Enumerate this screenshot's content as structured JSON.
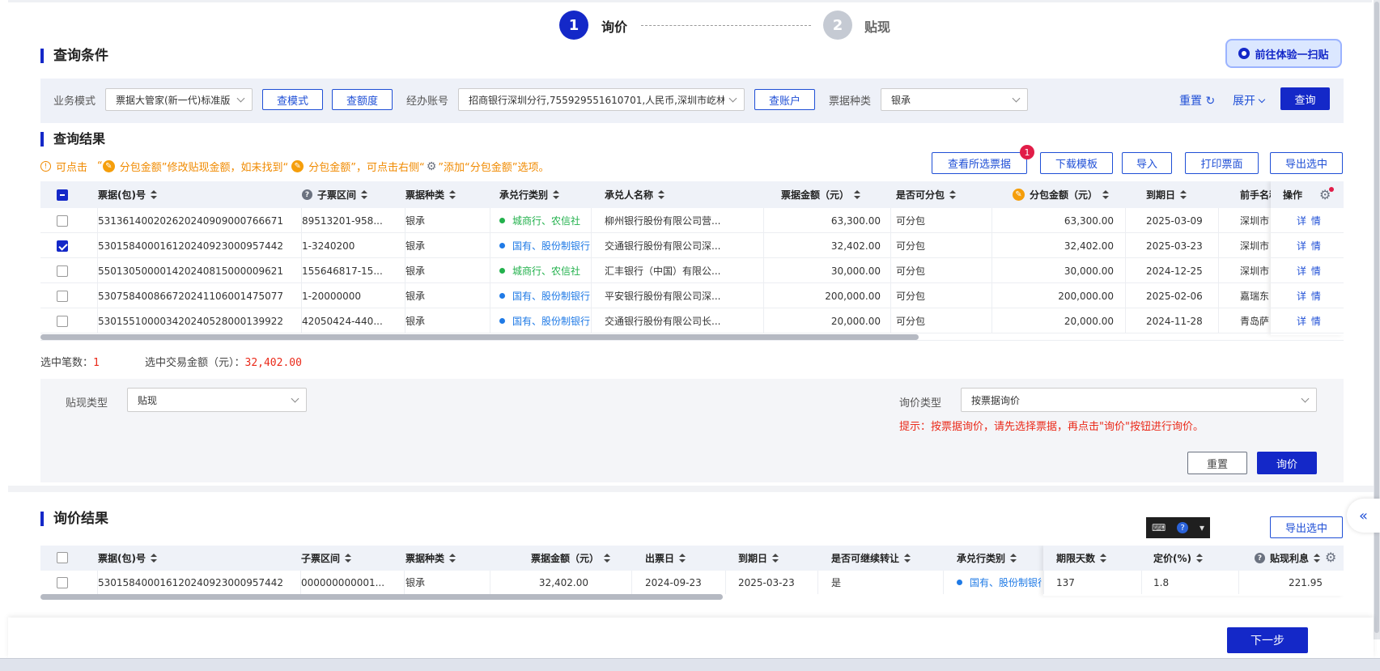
{
  "steps": [
    {
      "num": "1",
      "label": "询价"
    },
    {
      "num": "2",
      "label": "贴现"
    }
  ],
  "promo_button": "前往体验一扫贴",
  "query": {
    "title": "查询条件",
    "biz_mode_label": "业务模式",
    "biz_mode_value": "票据大管家(新一代)标准版",
    "check_mode_btn": "查模式",
    "check_quota_btn": "查额度",
    "account_label": "经办账号",
    "account_value": "招商银行深圳分行,755929551610701,人民币,深圳市屹林",
    "check_account_btn": "查账户",
    "bill_kind_label": "票据种类",
    "bill_kind_value": "银承",
    "reset": "重置",
    "expand": "展开",
    "query_btn": "查询"
  },
  "results": {
    "title": "查询结果",
    "tip_prefix": "可点击",
    "tip_q1": "“",
    "tip_text1": "分包金额”修改贴现金额，如未找到“",
    "tip_text2": "分包金额”，可点击右侧“",
    "tip_text3": "”添加“分包金额”选项。",
    "buttons": {
      "view_selected": "查看所选票据",
      "badge": "1",
      "download_template": "下载模板",
      "import": "导入",
      "print": "打印票面",
      "export": "导出选中"
    },
    "headers": {
      "bill_no": "票据(包)号",
      "sub_range": "子票区间",
      "bill_type": "票据种类",
      "acceptor_type": "承兑行类别",
      "acceptor_name": "承兑人名称",
      "amount": "票据金额（元）",
      "splittable": "是否可分包",
      "split_amount": "分包金额（元）",
      "due": "到期日",
      "prev_holder": "前手名称",
      "ops": "操作"
    },
    "rows": [
      {
        "no": "531361400202620240909000766671",
        "range": "89513201-958...",
        "type": "银承",
        "cat": "城商行、农信社",
        "cat_color": "#22b14c",
        "name": "柳州银行股份有限公司营...",
        "amount": "63,300.00",
        "split": "可分包",
        "split_amt": "63,300.00",
        "due": "2025-03-09",
        "prev": "深圳市",
        "op": "详 情",
        "checked": false
      },
      {
        "no": "530158400016120240923000957442",
        "range": "1-3240200",
        "type": "银承",
        "cat": "国有、股份制银行",
        "cat_color": "#1f7ae6",
        "name": "交通银行股份有限公司深...",
        "amount": "32,402.00",
        "split": "可分包",
        "split_amt": "32,402.00",
        "due": "2025-03-23",
        "prev": "深圳市",
        "op": "详 情",
        "checked": true
      },
      {
        "no": "550130500001420240815000009621",
        "range": "155646817-15...",
        "type": "银承",
        "cat": "城商行、农信社",
        "cat_color": "#22b14c",
        "name": "汇丰银行（中国）有限公...",
        "amount": "30,000.00",
        "split": "可分包",
        "split_amt": "30,000.00",
        "due": "2024-12-25",
        "prev": "深圳市",
        "op": "详 情",
        "checked": false
      },
      {
        "no": "530758400866720241106001475077",
        "range": "1-20000000",
        "type": "银承",
        "cat": "国有、股份制银行",
        "cat_color": "#1f7ae6",
        "name": "平安银行股份有限公司深...",
        "amount": "200,000.00",
        "split": "可分包",
        "split_amt": "200,000.00",
        "due": "2025-02-06",
        "prev": "嘉瑞东",
        "op": "详 情",
        "checked": false
      },
      {
        "no": "530155100003420240528000139922",
        "range": "42050424-440...",
        "type": "银承",
        "cat": "国有、股份制银行",
        "cat_color": "#1f7ae6",
        "name": "交通银行股份有限公司长...",
        "amount": "20,000.00",
        "split": "可分包",
        "split_amt": "20,000.00",
        "due": "2024-11-28",
        "prev": "青岛萨",
        "op": "详 情",
        "checked": false
      }
    ],
    "selected_count_label": "选中笔数：",
    "selected_count": "1",
    "selected_amount_label": "选中交易金额（元）：",
    "selected_amount": "32,402.00"
  },
  "discount": {
    "type_label": "贴现类型",
    "type_value": "贴现",
    "inquiry_type_label": "询价类型",
    "inquiry_type_value": "按票据询价",
    "hint": "提示：按票据询价，请先选择票据，再点击\"询价\"按钮进行询价。",
    "reset": "重置",
    "inquire": "询价"
  },
  "inquiry": {
    "title": "询价结果",
    "export": "导出选中",
    "headers": {
      "bill_no": "票据(包)号",
      "sub_range": "子票区间",
      "bill_type": "票据种类",
      "amount": "票据金额（元）",
      "issue": "出票日",
      "due": "到期日",
      "transferable": "是否可继续转让",
      "acceptor_type": "承兑行类别",
      "days": "期限天数",
      "price": "定价(%)",
      "interest": "贴现利息"
    },
    "rows": [
      {
        "no": "530158400016120240923000957442",
        "range": "000000000001...",
        "type": "银承",
        "amount": "32,402.00",
        "issue": "2024-09-23",
        "due": "2025-03-23",
        "transferable": "是",
        "cat": "国有、股份制银行",
        "cat_color": "#1f7ae6",
        "days": "137",
        "price": "1.8",
        "interest": "221.95"
      }
    ]
  },
  "next_btn": "下一步",
  "collapse_icon": "«"
}
